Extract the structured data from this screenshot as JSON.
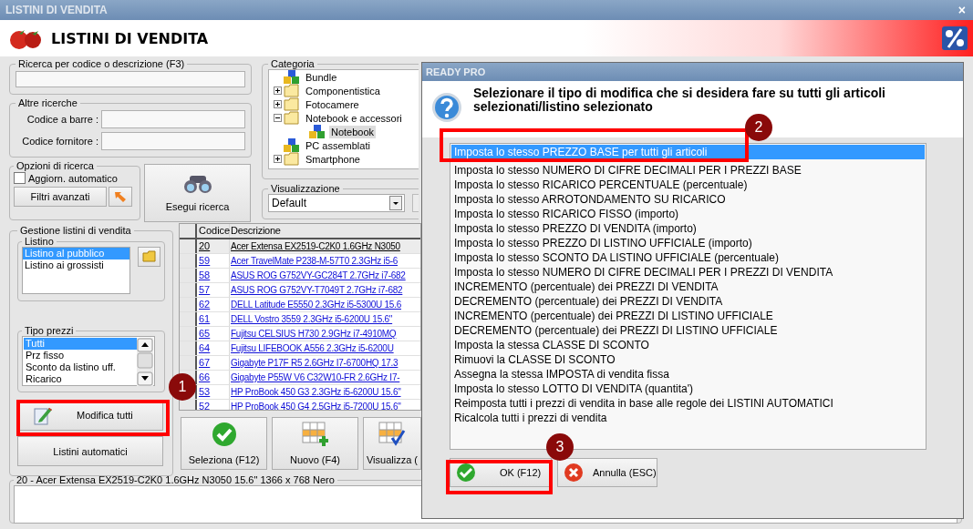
{
  "window": {
    "title": "LISTINI DI VENDITA",
    "close": "×"
  },
  "header": {
    "title": "LISTINI DI VENDITA"
  },
  "search": {
    "label": "Ricerca per codice o descrizione (F3)"
  },
  "other_searches": {
    "label": "Altre ricerche",
    "fields": [
      {
        "label": "Codice a barre :"
      },
      {
        "label": "Codice fornitore :"
      }
    ]
  },
  "search_options": {
    "label": "Opzioni di ricerca",
    "auto_update": {
      "label": "Aggiorn. automatico",
      "checked": false
    },
    "advanced_button": "Filtri avanzati"
  },
  "run_search_button": "Esegui ricerca",
  "category": {
    "label": "Categoria",
    "tree": [
      {
        "label": "Bundle",
        "kind": "group",
        "selected": false
      },
      {
        "label": "Componentistica",
        "kind": "folder",
        "expanded": false,
        "selected": false
      },
      {
        "label": "Fotocamere",
        "kind": "folder",
        "expanded": false,
        "selected": false
      },
      {
        "label": "Notebook e accessori",
        "kind": "folder",
        "expanded": true,
        "selected": false,
        "children": [
          {
            "label": "Notebook",
            "kind": "group",
            "selected": true
          }
        ]
      },
      {
        "label": "PC assemblati",
        "kind": "group",
        "selected": false
      },
      {
        "label": "Smartphone",
        "kind": "folder",
        "expanded": false,
        "selected": false
      }
    ]
  },
  "view": {
    "label": "Visualizzazione",
    "value": "Default"
  },
  "management": {
    "label": "Gestione listini di vendita",
    "price_lists": {
      "label": "Listino",
      "items": [
        {
          "label": "Listino al pubblico",
          "selected": true
        },
        {
          "label": "Listino ai grossisti",
          "selected": false
        }
      ]
    },
    "price_types": {
      "label": "Tipo prezzi",
      "items": [
        {
          "label": "Tutti",
          "selected": true
        },
        {
          "label": "Prz fisso",
          "selected": false
        },
        {
          "label": "Sconto da listino uff.",
          "selected": false
        },
        {
          "label": "Ricarico",
          "selected": false
        }
      ]
    },
    "edit_all_button": "Modifica tutti",
    "auto_lists_button": "Listini automatici"
  },
  "table": {
    "columns": [
      "Codice",
      "Descrizione"
    ],
    "rows": [
      {
        "code": "20",
        "description": "Acer Extensa EX2519-C2K0 1.6GHz N3050",
        "selected": true
      },
      {
        "code": "59",
        "description": "Acer TravelMate P238-M-57T0 2.3GHz i5-6",
        "selected": false
      },
      {
        "code": "58",
        "description": "ASUS ROG G752VY-GC284T 2.7GHz i7-682",
        "selected": false
      },
      {
        "code": "57",
        "description": "ASUS ROG G752VY-T7049T 2.7GHz i7-682",
        "selected": false
      },
      {
        "code": "62",
        "description": "DELL Latitude E5550 2.3GHz i5-5300U 15.6",
        "selected": false
      },
      {
        "code": "61",
        "description": "DELL Vostro 3559 2.3GHz i5-6200U 15.6\"",
        "selected": false
      },
      {
        "code": "65",
        "description": "Fujitsu CELSIUS H730 2.9GHz i7-4910MQ",
        "selected": false
      },
      {
        "code": "64",
        "description": "Fujitsu LIFEBOOK A556 2.3GHz i5-6200U",
        "selected": false
      },
      {
        "code": "67",
        "description": "Gigabyte P17F R5 2.6GHz I7-6700HQ 17.3",
        "selected": false
      },
      {
        "code": "66",
        "description": "Gigabyte P55W V6 C32W10-FR 2.6GHz I7-",
        "selected": false
      },
      {
        "code": "53",
        "description": "HP ProBook 450 G3 2.3GHz i5-6200U 15.6\"",
        "selected": false
      },
      {
        "code": "52",
        "description": "HP ProBook 450 G4 2.5GHz i5-7200U 15.6\"",
        "selected": false
      }
    ]
  },
  "actions": [
    {
      "label": "Seleziona (F12)",
      "kind": "select"
    },
    {
      "label": "Nuovo (F4)",
      "kind": "new"
    },
    {
      "label": "Visualizza (",
      "kind": "view"
    }
  ],
  "details": {
    "label": "20 - Acer Extensa EX2519-C2K0 1.6GHz N3050 15.6\" 1366 x 768 Nero"
  },
  "dialog": {
    "title": "READY PRO",
    "message": "Selezionare il tipo di modifica che si desidera fare su tutti gli articoli selezionati/listino selezionato",
    "options": [
      {
        "label": "Imposta lo stesso PREZZO BASE per tutti gli articoli",
        "selected": true
      },
      {
        "label": "Imposta lo stesso NUMERO DI CIFRE DECIMALI PER I PREZZI BASE",
        "selected": false
      },
      {
        "label": "Imposta lo stesso RICARICO PERCENTUALE (percentuale)",
        "selected": false
      },
      {
        "label": "Imposta lo stesso ARROTONDAMENTO SU RICARICO",
        "selected": false
      },
      {
        "label": "Imposta lo stesso RICARICO FISSO (importo)",
        "selected": false
      },
      {
        "label": "Imposta lo stesso PREZZO DI VENDITA (importo)",
        "selected": false
      },
      {
        "label": "Imposta lo stesso PREZZO DI LISTINO UFFICIALE (importo)",
        "selected": false
      },
      {
        "label": "Imposta lo stesso SCONTO DA LISTINO UFFICIALE (percentuale)",
        "selected": false
      },
      {
        "label": "Imposta lo stesso NUMERO DI CIFRE DECIMALI PER I PREZZI DI VENDITA",
        "selected": false
      },
      {
        "label": "INCREMENTO (percentuale) dei PREZZI DI VENDITA",
        "selected": false
      },
      {
        "label": "DECREMENTO (percentuale) dei PREZZI DI VENDITA",
        "selected": false
      },
      {
        "label": "INCREMENTO (percentuale) dei PREZZI DI LISTINO UFFICIALE",
        "selected": false
      },
      {
        "label": "DECREMENTO (percentuale) dei PREZZI DI LISTINO UFFICIALE",
        "selected": false
      },
      {
        "label": "Imposta la stessa CLASSE DI SCONTO",
        "selected": false
      },
      {
        "label": "Rimuovi la CLASSE DI SCONTO",
        "selected": false
      },
      {
        "label": "Assegna la stessa IMPOSTA di vendita fissa",
        "selected": false
      },
      {
        "label": "Imposta lo stesso LOTTO DI VENDITA (quantita')",
        "selected": false
      },
      {
        "label": "Reimposta tutti i prezzi di vendita in base alle regole dei LISTINI AUTOMATICI",
        "selected": false
      },
      {
        "label": "Ricalcola tutti i prezzi di vendita",
        "selected": false
      }
    ],
    "buttons": [
      {
        "label": "OK (F12)",
        "kind": "ok"
      },
      {
        "label": "Annulla (ESC)",
        "kind": "cancel"
      }
    ]
  },
  "annotations": [
    {
      "label": "1"
    },
    {
      "label": "2"
    },
    {
      "label": "3"
    }
  ]
}
